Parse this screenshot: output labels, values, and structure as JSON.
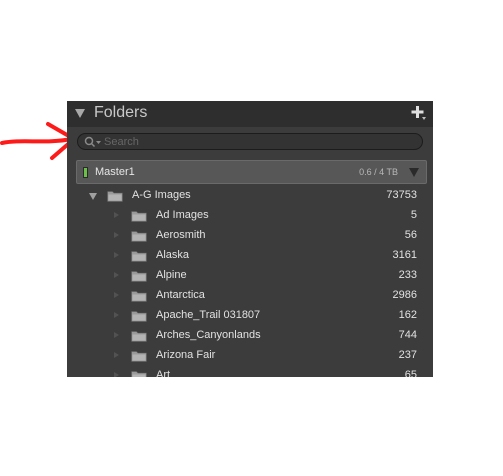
{
  "panel": {
    "title": "Folders",
    "add_icon": "plus-icon"
  },
  "search": {
    "placeholder": "Search",
    "value": "",
    "icon": "search-icon"
  },
  "volume": {
    "name": "Master1",
    "usage": "0.6 / 4 TB",
    "status_color": "#6cc04a"
  },
  "root_folder": {
    "name": "A-G Images",
    "count": "73753",
    "expanded": true
  },
  "subfolders": [
    {
      "name": "Ad Images",
      "count": "5"
    },
    {
      "name": "Aerosmith",
      "count": "56"
    },
    {
      "name": "Alaska",
      "count": "3161"
    },
    {
      "name": "Alpine",
      "count": "233"
    },
    {
      "name": "Antarctica",
      "count": "2986"
    },
    {
      "name": "Apache_Trail 031807",
      "count": "162"
    },
    {
      "name": "Arches_Canyonlands",
      "count": "744"
    },
    {
      "name": "Arizona Fair",
      "count": "237"
    },
    {
      "name": "Art",
      "count": "65"
    }
  ],
  "annotation": {
    "type": "red-arrow",
    "color": "#ff0000"
  }
}
